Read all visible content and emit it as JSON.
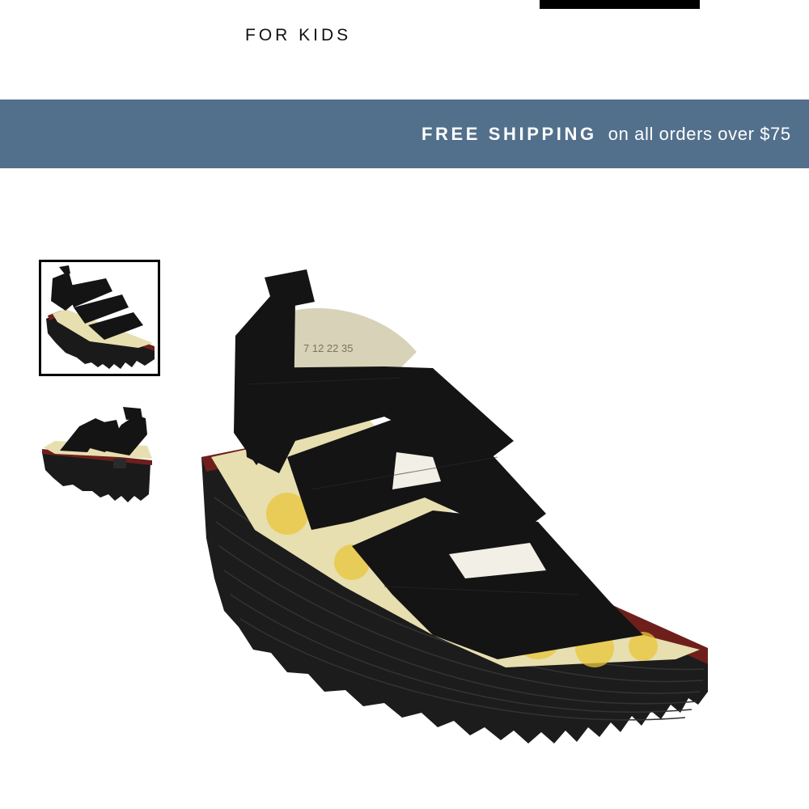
{
  "header": {
    "nav_link": "FOR KIDS"
  },
  "banner": {
    "strong": "FREE SHIPPING",
    "rest": "on all orders over $75"
  },
  "product": {
    "image_icon": "wedge-sandal-image",
    "thumbnails": [
      {
        "icon": "sandal-front-view",
        "selected": true
      },
      {
        "icon": "sandal-back-view",
        "selected": false
      }
    ],
    "insole_print": "7 12 22 35",
    "colors": {
      "strap": "#141414",
      "sole": "#1c1c1c",
      "welt": "#6e1f1c",
      "insole": "#e7dfb0",
      "insole_pattern": "#e9c63b",
      "banner": "#52708c"
    }
  }
}
